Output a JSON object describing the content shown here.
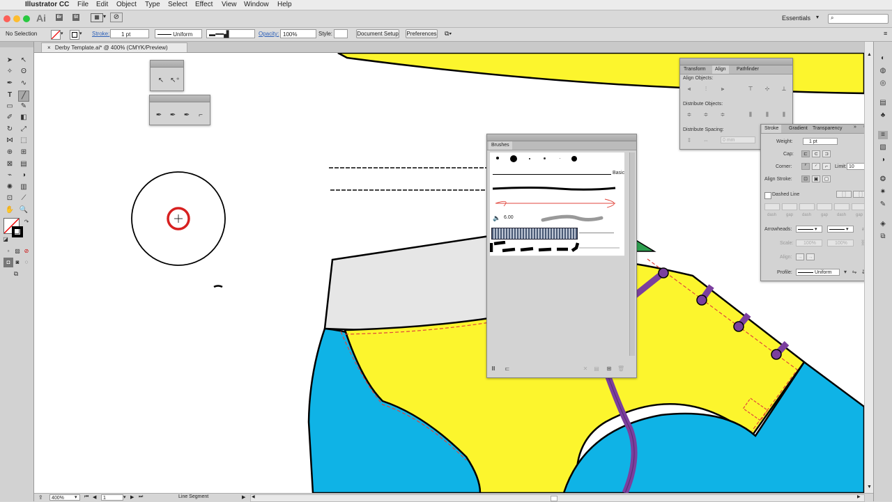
{
  "menubar": {
    "app": "Illustrator CC",
    "items": [
      "File",
      "Edit",
      "Object",
      "Type",
      "Select",
      "Effect",
      "View",
      "Window",
      "Help"
    ]
  },
  "appbar": {
    "logo": "Ai",
    "br": "Br",
    "st": "St",
    "workspace": "Essentials",
    "search_placeholder": ""
  },
  "controlbar": {
    "selection": "No Selection",
    "stroke_label": "Stroke:",
    "stroke_value": "1 pt",
    "profile": "Uniform",
    "opacity_label": "Opacity:",
    "opacity_value": "100%",
    "style_label": "Style:",
    "document_setup": "Document Setup",
    "preferences": "Preferences"
  },
  "document": {
    "tab_title": "Derby Template.ai* @ 400% (CMYK/Preview)"
  },
  "align_panel": {
    "tabs": [
      "Transform",
      "Align",
      "Pathfinder"
    ],
    "active_tab": "Align",
    "align_objects": "Align Objects:",
    "distribute_objects": "Distribute Objects:",
    "distribute_spacing": "Distribute Spacing:",
    "spacing_value": "0 mm"
  },
  "stroke_panel": {
    "tabs": [
      "Stroke",
      "Gradient",
      "Transparency"
    ],
    "active_tab": "Stroke",
    "weight_label": "Weight:",
    "weight_value": "1 pt",
    "cap_label": "Cap:",
    "corner_label": "Corner:",
    "limit_label": "Limit:",
    "limit_value": "10",
    "limit_unit": "x",
    "align_stroke_label": "Align Stroke:",
    "dashed_line_label": "Dashed Line",
    "dash_labels": [
      "dash",
      "gap",
      "dash",
      "gap",
      "dash",
      "gap"
    ],
    "arrowheads_label": "Arrowheads:",
    "scale_label": "Scale:",
    "scale_values": [
      "100%",
      "100%"
    ],
    "align_label": "Align:",
    "profile_label": "Profile:",
    "profile_value": "Uniform"
  },
  "brushes_panel": {
    "title": "Brushes",
    "basic_label": "Basic",
    "bristle_size": "6.00"
  },
  "statusbar": {
    "zoom": "400%",
    "artboard": "1",
    "tool": "Line Segment"
  },
  "colors": {
    "yellow": "#fcf52d",
    "cyan": "#0fb3e6",
    "purple": "#7b3f9e",
    "green": "#2e9e4f",
    "grey_fill": "#e6e6e6",
    "stitch": "#e0463c",
    "red_marker": "#d72020"
  }
}
